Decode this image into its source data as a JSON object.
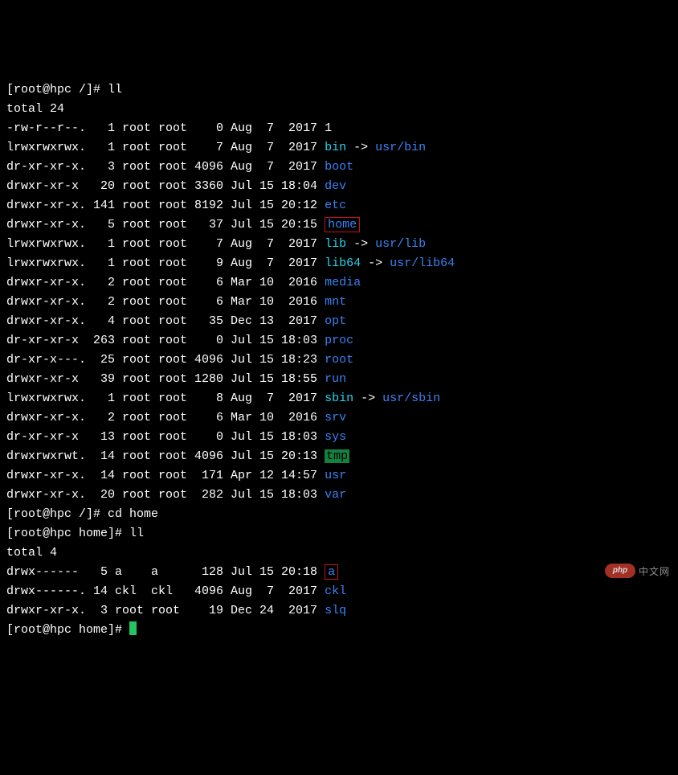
{
  "prompt1": "[root@hpc /]# ",
  "cmd1": "ll",
  "total1": "total 24",
  "rows": [
    {
      "perm": "-rw-r--r--.",
      "links": "1",
      "owner": "root",
      "group": "root",
      "size": "0",
      "m": "Aug",
      "d": "7",
      "t": "2017",
      "name": "1",
      "cls": ""
    },
    {
      "perm": "lrwxrwxrwx.",
      "links": "1",
      "owner": "root",
      "group": "root",
      "size": "7",
      "m": "Aug",
      "d": "7",
      "t": "2017",
      "name": "bin",
      "cls": "cyan",
      "arrow": " -> ",
      "target": "usr/bin"
    },
    {
      "perm": "dr-xr-xr-x.",
      "links": "3",
      "owner": "root",
      "group": "root",
      "size": "4096",
      "m": "Aug",
      "d": "7",
      "t": "2017",
      "name": "boot",
      "cls": "dir"
    },
    {
      "perm": "drwxr-xr-x",
      "links": "20",
      "owner": "root",
      "group": "root",
      "size": "3360",
      "m": "Jul",
      "d": "15",
      "t": "18:04",
      "name": "dev",
      "cls": "dir"
    },
    {
      "perm": "drwxr-xr-x.",
      "links": "141",
      "owner": "root",
      "group": "root",
      "size": "8192",
      "m": "Jul",
      "d": "15",
      "t": "20:12",
      "name": "etc",
      "cls": "dir"
    },
    {
      "perm": "drwxr-xr-x.",
      "links": "5",
      "owner": "root",
      "group": "root",
      "size": "37",
      "m": "Jul",
      "d": "15",
      "t": "20:15",
      "name": "home",
      "cls": "highlight-red"
    },
    {
      "perm": "lrwxrwxrwx.",
      "links": "1",
      "owner": "root",
      "group": "root",
      "size": "7",
      "m": "Aug",
      "d": "7",
      "t": "2017",
      "name": "lib",
      "cls": "cyan",
      "arrow": " -> ",
      "target": "usr/lib"
    },
    {
      "perm": "lrwxrwxrwx.",
      "links": "1",
      "owner": "root",
      "group": "root",
      "size": "9",
      "m": "Aug",
      "d": "7",
      "t": "2017",
      "name": "lib64",
      "cls": "cyan",
      "arrow": " -> ",
      "target": "usr/lib64"
    },
    {
      "perm": "drwxr-xr-x.",
      "links": "2",
      "owner": "root",
      "group": "root",
      "size": "6",
      "m": "Mar",
      "d": "10",
      "t": "2016",
      "name": "media",
      "cls": "dir"
    },
    {
      "perm": "drwxr-xr-x.",
      "links": "2",
      "owner": "root",
      "group": "root",
      "size": "6",
      "m": "Mar",
      "d": "10",
      "t": "2016",
      "name": "mnt",
      "cls": "dir"
    },
    {
      "perm": "drwxr-xr-x.",
      "links": "4",
      "owner": "root",
      "group": "root",
      "size": "35",
      "m": "Dec",
      "d": "13",
      "t": "2017",
      "name": "opt",
      "cls": "dir"
    },
    {
      "perm": "dr-xr-xr-x",
      "links": "263",
      "owner": "root",
      "group": "root",
      "size": "0",
      "m": "Jul",
      "d": "15",
      "t": "18:03",
      "name": "proc",
      "cls": "dir"
    },
    {
      "perm": "dr-xr-x---.",
      "links": "25",
      "owner": "root",
      "group": "root",
      "size": "4096",
      "m": "Jul",
      "d": "15",
      "t": "18:23",
      "name": "root",
      "cls": "dir"
    },
    {
      "perm": "drwxr-xr-x",
      "links": "39",
      "owner": "root",
      "group": "root",
      "size": "1280",
      "m": "Jul",
      "d": "15",
      "t": "18:55",
      "name": "run",
      "cls": "dir"
    },
    {
      "perm": "lrwxrwxrwx.",
      "links": "1",
      "owner": "root",
      "group": "root",
      "size": "8",
      "m": "Aug",
      "d": "7",
      "t": "2017",
      "name": "sbin",
      "cls": "cyan",
      "arrow": " -> ",
      "target": "usr/sbin"
    },
    {
      "perm": "drwxr-xr-x.",
      "links": "2",
      "owner": "root",
      "group": "root",
      "size": "6",
      "m": "Mar",
      "d": "10",
      "t": "2016",
      "name": "srv",
      "cls": "dir"
    },
    {
      "perm": "dr-xr-xr-x",
      "links": "13",
      "owner": "root",
      "group": "root",
      "size": "0",
      "m": "Jul",
      "d": "15",
      "t": "18:03",
      "name": "sys",
      "cls": "dir"
    },
    {
      "perm": "drwxrwxrwt.",
      "links": "14",
      "owner": "root",
      "group": "root",
      "size": "4096",
      "m": "Jul",
      "d": "15",
      "t": "20:13",
      "name": "tmp",
      "cls": "sticky"
    },
    {
      "perm": "drwxr-xr-x.",
      "links": "14",
      "owner": "root",
      "group": "root",
      "size": "171",
      "m": "Apr",
      "d": "12",
      "t": "14:57",
      "name": "usr",
      "cls": "dir"
    },
    {
      "perm": "drwxr-xr-x.",
      "links": "20",
      "owner": "root",
      "group": "root",
      "size": "282",
      "m": "Jul",
      "d": "15",
      "t": "18:03",
      "name": "var",
      "cls": "dir"
    }
  ],
  "prompt2": "[root@hpc /]# ",
  "cmd2": "cd home",
  "prompt3": "[root@hpc home]# ",
  "cmd3": "ll",
  "total2": "total 4",
  "rows2": [
    {
      "perm": "drwx------",
      "links": "5",
      "owner": "a",
      "group": "a",
      "size": "128",
      "m": "Jul",
      "d": "15",
      "t": "20:18",
      "name": "a",
      "cls": "highlight-red2"
    },
    {
      "perm": "drwx------.",
      "links": "14",
      "owner": "ckl",
      "group": "ckl",
      "size": "4096",
      "m": "Aug",
      "d": "7",
      "t": "2017",
      "name": "ckl",
      "cls": "dir"
    },
    {
      "perm": "drwxr-xr-x.",
      "links": "3",
      "owner": "root",
      "group": "root",
      "size": "19",
      "m": "Dec",
      "d": "24",
      "t": "2017",
      "name": "slq",
      "cls": "dir"
    }
  ],
  "prompt4": "[root@hpc home]# ",
  "watermark_logo": "php",
  "watermark_text": "中文网"
}
